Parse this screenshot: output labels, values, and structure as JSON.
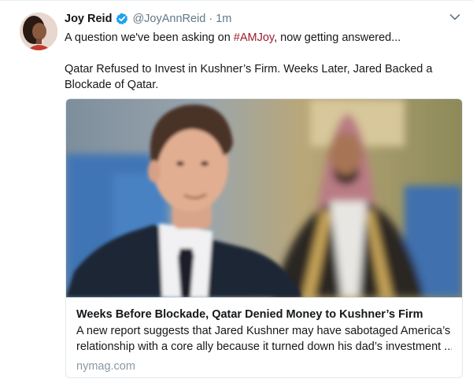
{
  "tweet": {
    "author_name": "Joy Reid",
    "author_handle": "@JoyAnnReid",
    "separator": "·",
    "timestamp": "1m",
    "text_before_hashtag": "A question we've been asking on ",
    "hashtag": "#AMJoy",
    "text_after_hashtag": ", now getting answered...",
    "line2": "Qatar Refused to Invest in Kushner’s Firm. Weeks Later, Jared Backed a",
    "line3": "Blockade of Qatar."
  },
  "card": {
    "title": "Weeks Before Blockade, Qatar Denied Money to Kushner’s Firm",
    "description_line1": "A new report suggests that Jared Kushner may have sabotaged America’s",
    "description_line2": "relationship with a core ally because it turned down his dad’s investment ...",
    "domain": "nymag.com"
  },
  "icons": {
    "verified": "verified-badge-icon",
    "caret": "chevron-down-icon"
  },
  "colors": {
    "hashtag": "#9e1a2b",
    "verified": "#1da1f2",
    "muted": "#657786",
    "domain": "#8899a6",
    "border": "#e1e8ed"
  }
}
